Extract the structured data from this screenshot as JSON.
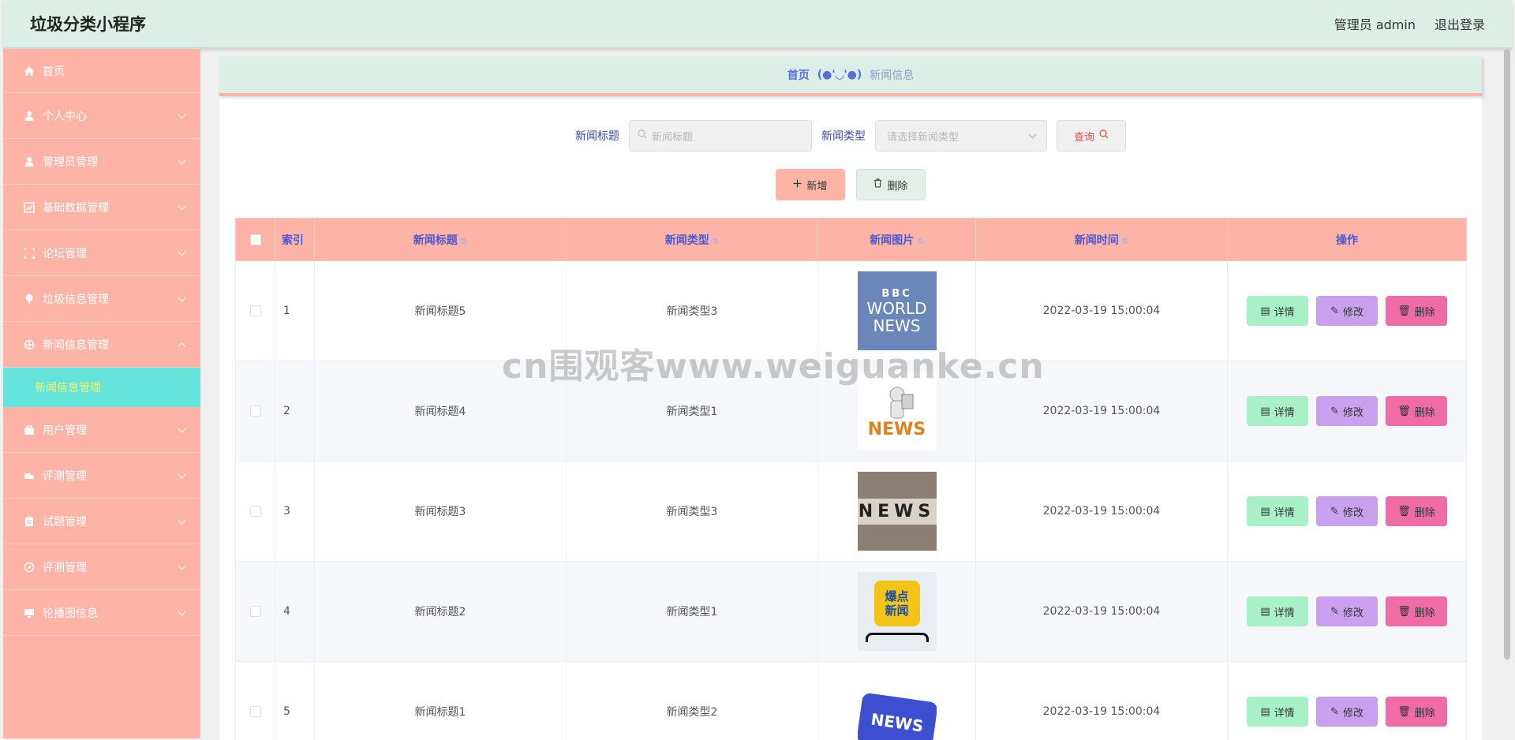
{
  "header": {
    "title": "垃圾分类小程序",
    "user": "管理员 admin",
    "logout": "退出登录"
  },
  "sidebar": {
    "home": "首页",
    "items": [
      {
        "label": "个人中心",
        "icon": "user-icon"
      },
      {
        "label": "管理员管理",
        "icon": "user-icon"
      },
      {
        "label": "基础数据管理",
        "icon": "chart-icon"
      },
      {
        "label": "论坛管理",
        "icon": "frame-icon"
      },
      {
        "label": "垃圾信息管理",
        "icon": "pin-icon"
      },
      {
        "label": "新闻信息管理",
        "icon": "globe-icon"
      }
    ],
    "active_sub": "新闻信息管理",
    "items_after": [
      {
        "label": "用户管理",
        "icon": "users-icon"
      },
      {
        "label": "评测管理",
        "icon": "truck-icon"
      },
      {
        "label": "试题管理",
        "icon": "clipboard-icon"
      },
      {
        "label": "评测管理",
        "icon": "compass-icon"
      },
      {
        "label": "轮播图信息",
        "icon": "monitor-icon"
      }
    ]
  },
  "breadcrumb": {
    "home": "首页",
    "separator": "(●'◡'●)",
    "current": "新闻信息"
  },
  "search": {
    "title_label": "新闻标题",
    "title_placeholder": "新闻标题",
    "type_label": "新闻类型",
    "type_placeholder": "请选择新闻类型",
    "query_label": "查询"
  },
  "actions": {
    "add_label": "新增",
    "delete_label": "删除"
  },
  "table": {
    "headers": {
      "index": "索引",
      "title": "新闻标题",
      "type": "新闻类型",
      "image": "新闻图片",
      "time": "新闻时间",
      "ops": "操作"
    },
    "op_labels": {
      "detail": "详情",
      "edit": "修改",
      "delete": "删除"
    },
    "rows": [
      {
        "index": "1",
        "title": "新闻标题5",
        "type": "新闻类型3",
        "time": "2022-03-19 15:00:04"
      },
      {
        "index": "2",
        "title": "新闻标题4",
        "type": "新闻类型1",
        "time": "2022-03-19 15:00:04"
      },
      {
        "index": "3",
        "title": "新闻标题3",
        "type": "新闻类型3",
        "time": "2022-03-19 15:00:04"
      },
      {
        "index": "4",
        "title": "新闻标题2",
        "type": "新闻类型1",
        "time": "2022-03-19 15:00:04"
      },
      {
        "index": "5",
        "title": "新闻标题1",
        "type": "新闻类型2",
        "time": "2022-03-19 15:00:04"
      }
    ],
    "images": [
      {
        "lines": [
          "BBC",
          "WORLD",
          "NEWS"
        ]
      },
      {
        "text": "NEWS"
      },
      {
        "text": "NEWS"
      },
      {
        "lines": [
          "爆点",
          "新闻"
        ]
      },
      {
        "text": "NEWS"
      }
    ]
  },
  "watermark": "cn围观客www.weiguanke.cn",
  "colors": {
    "header_bg": "#dcefe7",
    "sidebar_bg": "#fdb4a6",
    "active_sub_bg": "#64e3da",
    "active_sub_text": "#f6f36a",
    "table_head_bg": "#fdb4a6",
    "detail_btn": "#a8f0c6",
    "edit_btn": "#c9a0ee",
    "delete_btn": "#f06ca6"
  }
}
